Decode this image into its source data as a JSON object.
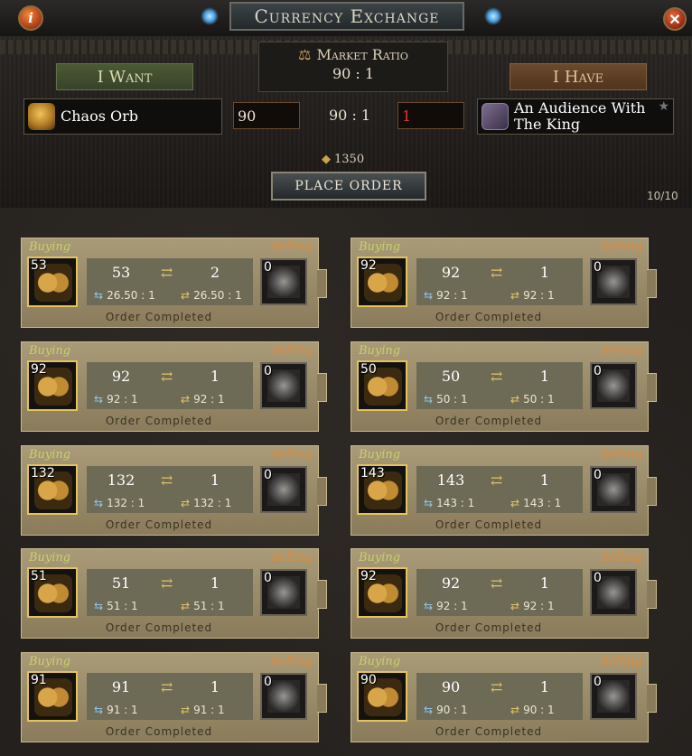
{
  "header": {
    "title": "Currency Exchange",
    "info_icon_label": "i",
    "close_icon_label": "✕"
  },
  "exchange": {
    "market_ratio_label": "Market Ratio",
    "market_ratio_value": "90 : 1",
    "want_tab": "I Want",
    "have_tab": "I Have",
    "want_currency": "Chaos Orb",
    "have_currency_line1": "An Audience With",
    "have_currency_line2": "The King",
    "want_amount": "90",
    "have_amount": "1",
    "ratio_between": "90 : 1",
    "gold_amount": "1350",
    "place_order_label": "PLACE ORDER",
    "order_count": "10/10"
  },
  "orders": [
    {
      "buying_label": "Buying",
      "selling_label": "Selling",
      "left_count": "53",
      "want": "53",
      "have": "2",
      "rate_left": "26.50 : 1",
      "rate_right": "26.50 : 1",
      "right_count": "0",
      "status": "Order Completed"
    },
    {
      "buying_label": "Buying",
      "selling_label": "Selling",
      "left_count": "92",
      "want": "92",
      "have": "1",
      "rate_left": "92 : 1",
      "rate_right": "92 : 1",
      "right_count": "0",
      "status": "Order Completed"
    },
    {
      "buying_label": "Buying",
      "selling_label": "Selling",
      "left_count": "92",
      "want": "92",
      "have": "1",
      "rate_left": "92 : 1",
      "rate_right": "92 : 1",
      "right_count": "0",
      "status": "Order Completed"
    },
    {
      "buying_label": "Buying",
      "selling_label": "Selling",
      "left_count": "50",
      "want": "50",
      "have": "1",
      "rate_left": "50 : 1",
      "rate_right": "50 : 1",
      "right_count": "0",
      "status": "Order Completed"
    },
    {
      "buying_label": "Buying",
      "selling_label": "Selling",
      "left_count": "132",
      "want": "132",
      "have": "1",
      "rate_left": "132 : 1",
      "rate_right": "132 : 1",
      "right_count": "0",
      "status": "Order Completed"
    },
    {
      "buying_label": "Buying",
      "selling_label": "Selling",
      "left_count": "143",
      "want": "143",
      "have": "1",
      "rate_left": "143 : 1",
      "rate_right": "143 : 1",
      "right_count": "0",
      "status": "Order Completed"
    },
    {
      "buying_label": "Buying",
      "selling_label": "Selling",
      "left_count": "51",
      "want": "51",
      "have": "1",
      "rate_left": "51 : 1",
      "rate_right": "51 : 1",
      "right_count": "0",
      "status": "Order Completed"
    },
    {
      "buying_label": "Buying",
      "selling_label": "Selling",
      "left_count": "92",
      "want": "92",
      "have": "1",
      "rate_left": "92 : 1",
      "rate_right": "92 : 1",
      "right_count": "0",
      "status": "Order Completed"
    },
    {
      "buying_label": "Buying",
      "selling_label": "Selling",
      "left_count": "91",
      "want": "91",
      "have": "1",
      "rate_left": "91 : 1",
      "rate_right": "91 : 1",
      "right_count": "0",
      "status": "Order Completed"
    },
    {
      "buying_label": "Buying",
      "selling_label": "Selling",
      "left_count": "90",
      "want": "90",
      "have": "1",
      "rate_left": "90 : 1",
      "rate_right": "90 : 1",
      "right_count": "0",
      "status": "Order Completed"
    }
  ],
  "colors": {
    "buying": "#c8d06a",
    "selling": "#e08a3a",
    "have_amount": "#e13a2a"
  }
}
